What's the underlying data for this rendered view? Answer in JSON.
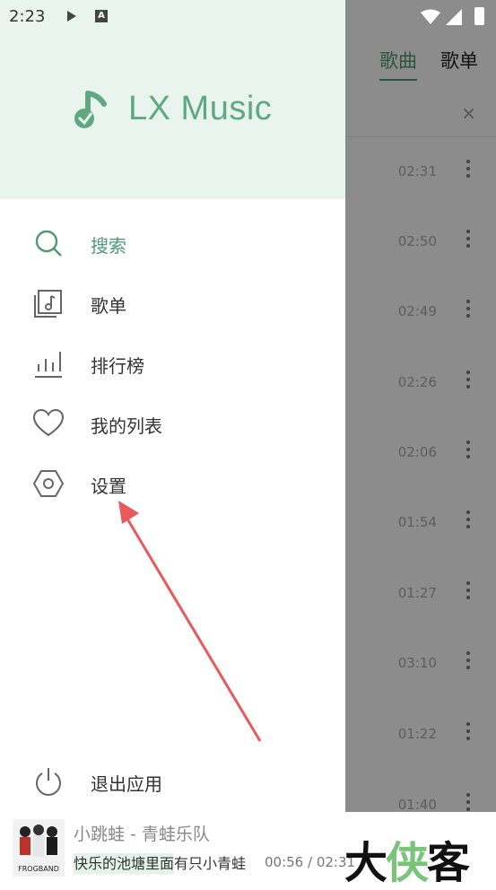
{
  "status_bar": {
    "time": "2:23",
    "notification_letter": "A"
  },
  "background_app": {
    "tabs": [
      "歌曲",
      "歌单"
    ],
    "close_symbol": "×",
    "durations": [
      "02:31",
      "02:50",
      "02:49",
      "02:26",
      "02:06",
      "01:54",
      "01:27",
      "03:10",
      "01:22",
      "01:40"
    ]
  },
  "drawer": {
    "brand": "LX Music",
    "menu": [
      {
        "label": "搜索",
        "icon": "search-icon"
      },
      {
        "label": "歌单",
        "icon": "playlist-icon"
      },
      {
        "label": "排行榜",
        "icon": "chart-icon"
      },
      {
        "label": "我的列表",
        "icon": "heart-icon"
      },
      {
        "label": "设置",
        "icon": "settings-icon"
      }
    ],
    "exit_label": "退出应用"
  },
  "player": {
    "track": "小跳蛙 - 青蛙乐队",
    "lyric_highlight": "快乐的池塘里面",
    "lyric_rest": "有只小青蛙",
    "time": "00:56 / 02:31",
    "cover_text": "FROGBAND"
  },
  "watermark": {
    "part1": "大",
    "part2": "侠",
    "part3": "客"
  },
  "colors": {
    "accent": "#4f9a73",
    "header_bg": "#e9f4ee",
    "arrow": "#e8595a"
  }
}
